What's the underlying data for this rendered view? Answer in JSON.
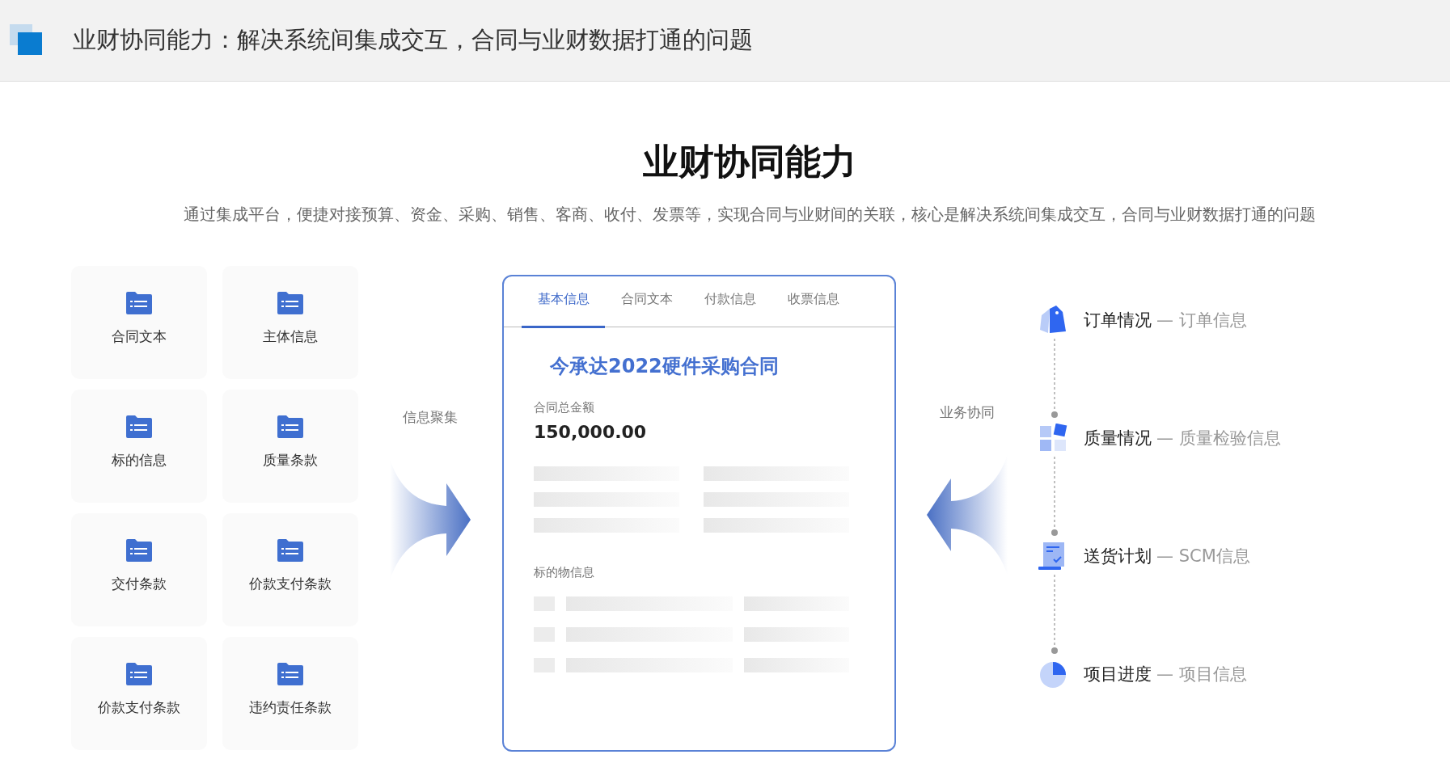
{
  "header": {
    "title": "业财协同能力：解决系统间集成交互，合同与业财数据打通的问题"
  },
  "section": {
    "title": "业财协同能力",
    "subtitle": "通过集成平台，便捷对接预算、资金、采购、销售、客商、收付、发票等，实现合同与业财间的关联，核心是解决系统间集成交互，合同与业财数据打通的问题"
  },
  "modules": [
    {
      "label": "合同文本"
    },
    {
      "label": "主体信息"
    },
    {
      "label": "标的信息"
    },
    {
      "label": "质量条款"
    },
    {
      "label": "交付条款"
    },
    {
      "label": "价款支付条款"
    },
    {
      "label": "价款支付条款"
    },
    {
      "label": "违约责任条款"
    }
  ],
  "left_arrow": {
    "label": "信息聚集"
  },
  "contract_card": {
    "tabs": [
      {
        "label": "基本信息",
        "selected": true
      },
      {
        "label": "合同文本",
        "selected": false
      },
      {
        "label": "付款信息",
        "selected": false
      },
      {
        "label": "收票信息",
        "selected": false
      }
    ],
    "title": "今承达2022硬件采购合同",
    "amount_label": "合同总金额",
    "amount": "150,000.00",
    "items_label": "标的物信息"
  },
  "right_arrow": {
    "label": "业务协同"
  },
  "flows": [
    {
      "kind": "tag",
      "title": "订单情况",
      "detail": "— 订单信息"
    },
    {
      "kind": "tiles",
      "title": "质量情况",
      "detail": "— 质量检验信息"
    },
    {
      "kind": "document",
      "title": "送货计划",
      "detail": "— SCM信息"
    },
    {
      "kind": "pie",
      "title": "项目进度",
      "detail": "— 项目信息"
    }
  ]
}
